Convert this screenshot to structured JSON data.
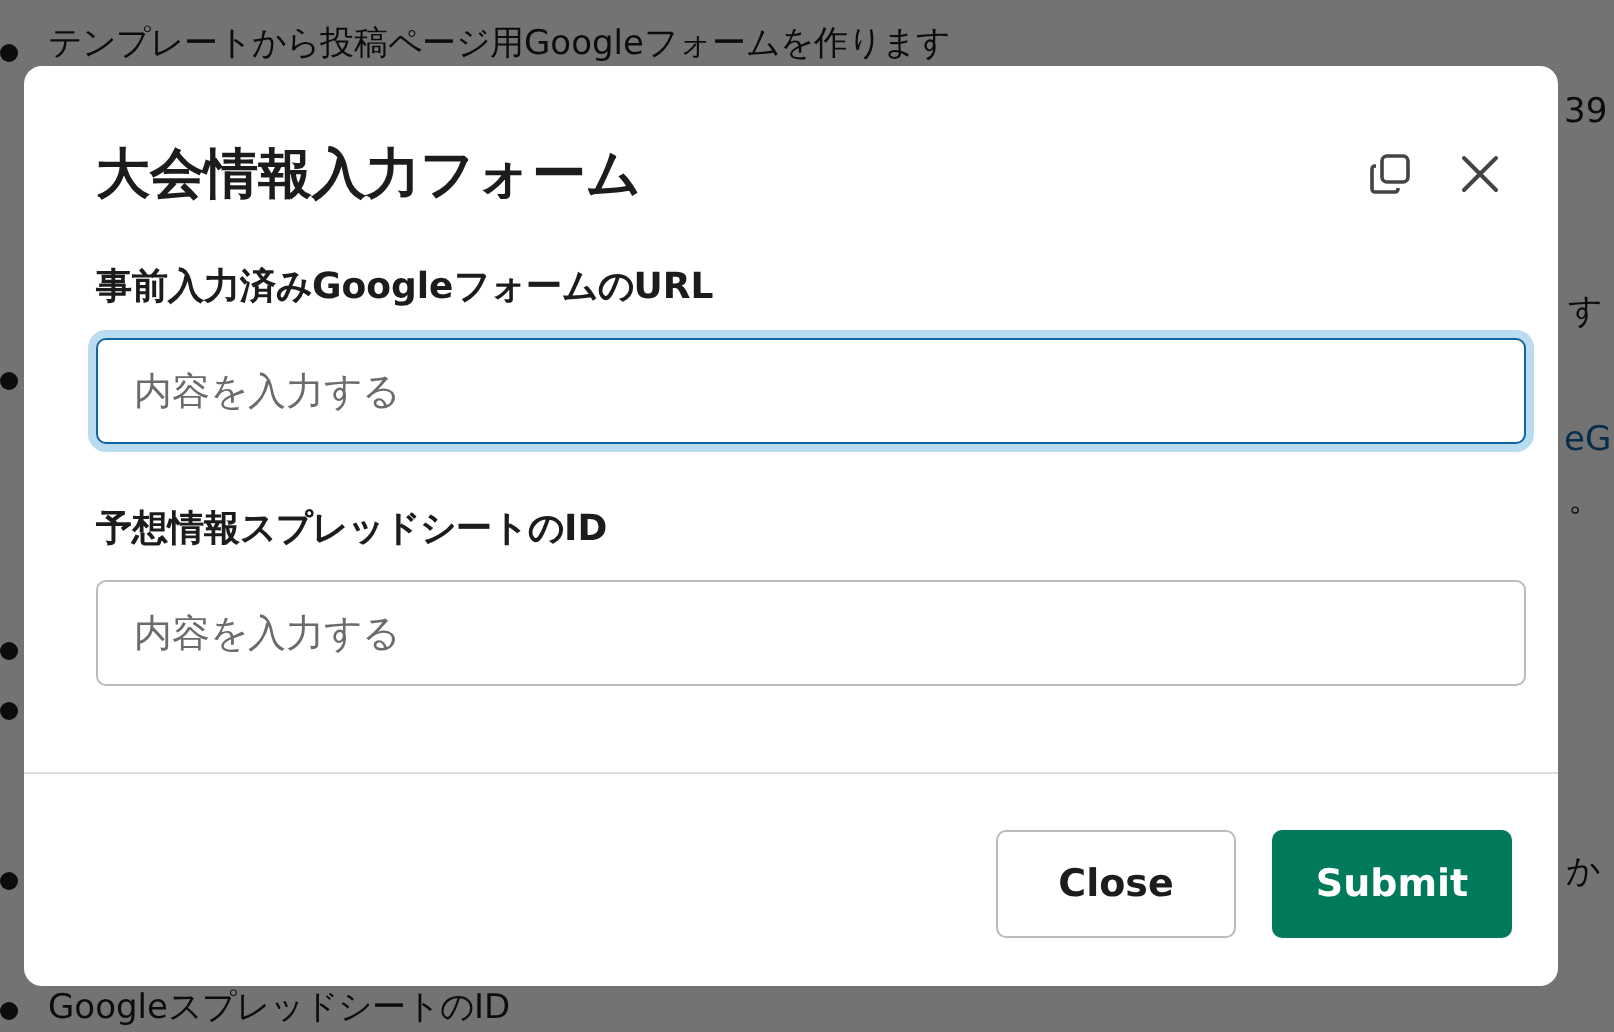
{
  "background": {
    "lines": [
      {
        "kind": "text",
        "text": "テンプレートから投稿ページ用Googleフォームを作ります"
      },
      {
        "kind": "text",
        "text": "39"
      },
      {
        "kind": "text",
        "text": "す"
      },
      {
        "kind": "link",
        "text": "eG"
      },
      {
        "kind": "text",
        "text": "。"
      },
      {
        "kind": "text",
        "text": "か"
      },
      {
        "kind": "text",
        "text": "GoogleスプレッドシートのID"
      }
    ]
  },
  "modal": {
    "title": "大会情報入力フォーム",
    "fields": [
      {
        "label": "事前入力済みGoogleフォームのURL",
        "placeholder": "内容を入力する",
        "focused": true
      },
      {
        "label": "予想情報スプレッドシートのID",
        "placeholder": "内容を入力する",
        "focused": false
      }
    ],
    "buttons": [
      {
        "label": "Close",
        "kind": "secondary"
      },
      {
        "label": "Submit",
        "kind": "primary"
      }
    ]
  }
}
